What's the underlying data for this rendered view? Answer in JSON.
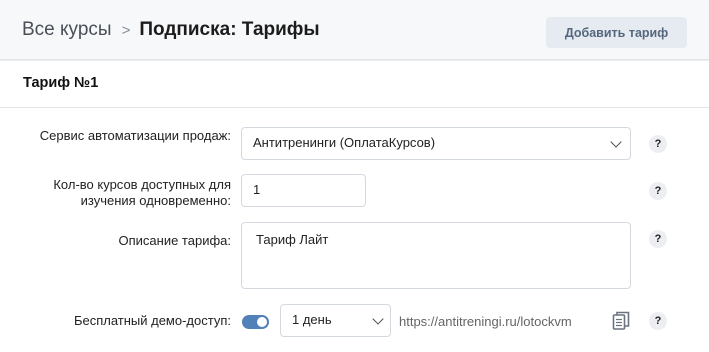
{
  "header": {
    "breadcrumb_root": "Все курсы",
    "breadcrumb_separator": ">",
    "breadcrumb_current": "Подписка: Тарифы",
    "add_button_label": "Добавить тариф"
  },
  "tariff": {
    "title": "Тариф №1",
    "service": {
      "label": "Сервис автоматизации продаж:",
      "value": "Антитренинги (ОплатаКурсов)"
    },
    "courses_count": {
      "label": "Кол-во курсов доступных для изучения одновременно:",
      "value": "1"
    },
    "description": {
      "label": "Описание тарифа:",
      "value": "Тариф Лайт"
    },
    "demo": {
      "label": "Бесплатный демо-доступ:",
      "enabled": true,
      "duration": "1 день",
      "link": "https://antitreningi.ru/lotockvm"
    },
    "help_label": "?"
  },
  "colors": {
    "accent": "#5181b8",
    "header_bg": "#f7f8fa",
    "button_bg": "#e5ebf1",
    "border": "#d3d9de"
  },
  "icons": {
    "dropdown": "chevron-down-icon",
    "copy": "copy-icon",
    "help": "help-icon"
  }
}
